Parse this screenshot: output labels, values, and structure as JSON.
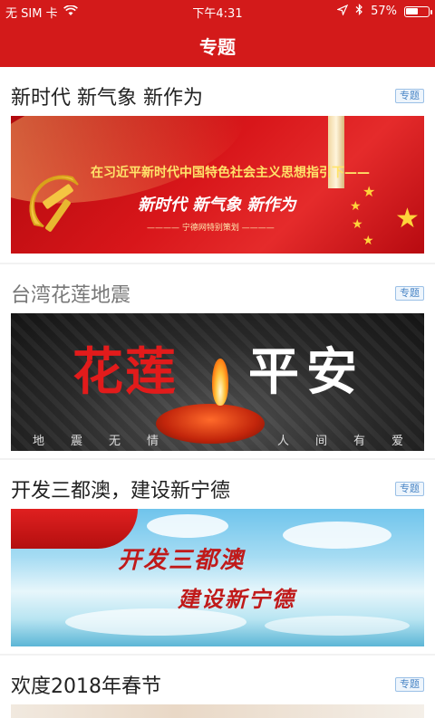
{
  "status_bar": {
    "carrier": "无 SIM 卡",
    "time": "下午4:31",
    "battery_percent": "57%",
    "battery_level": 0.57
  },
  "header": {
    "title": "专题"
  },
  "topics": [
    {
      "title": "新时代 新气象 新作为",
      "tag": "专题",
      "banner": {
        "line1": "在习近平新时代中国特色社会主义思想指引下——",
        "line2": "新时代  新气象  新作为",
        "line3": "———— 宁德网特别策划 ————"
      }
    },
    {
      "title": "台湾花莲地震",
      "tag": "专题",
      "banner": {
        "big_left": "花莲",
        "big_right": "平安",
        "caption_chars": [
          "地",
          "震",
          "无",
          "情",
          "人",
          "间",
          "有",
          "爱"
        ]
      }
    },
    {
      "title": "开发三都澳，建设新宁德",
      "tag": "专题",
      "banner": {
        "line1": "开发三都澳",
        "line2": "建设新宁德"
      }
    },
    {
      "title": "欢度2018年春节",
      "tag": "专题"
    }
  ],
  "colors": {
    "header_red": "#d31a1a",
    "tag_blue": "#4a86c6"
  }
}
